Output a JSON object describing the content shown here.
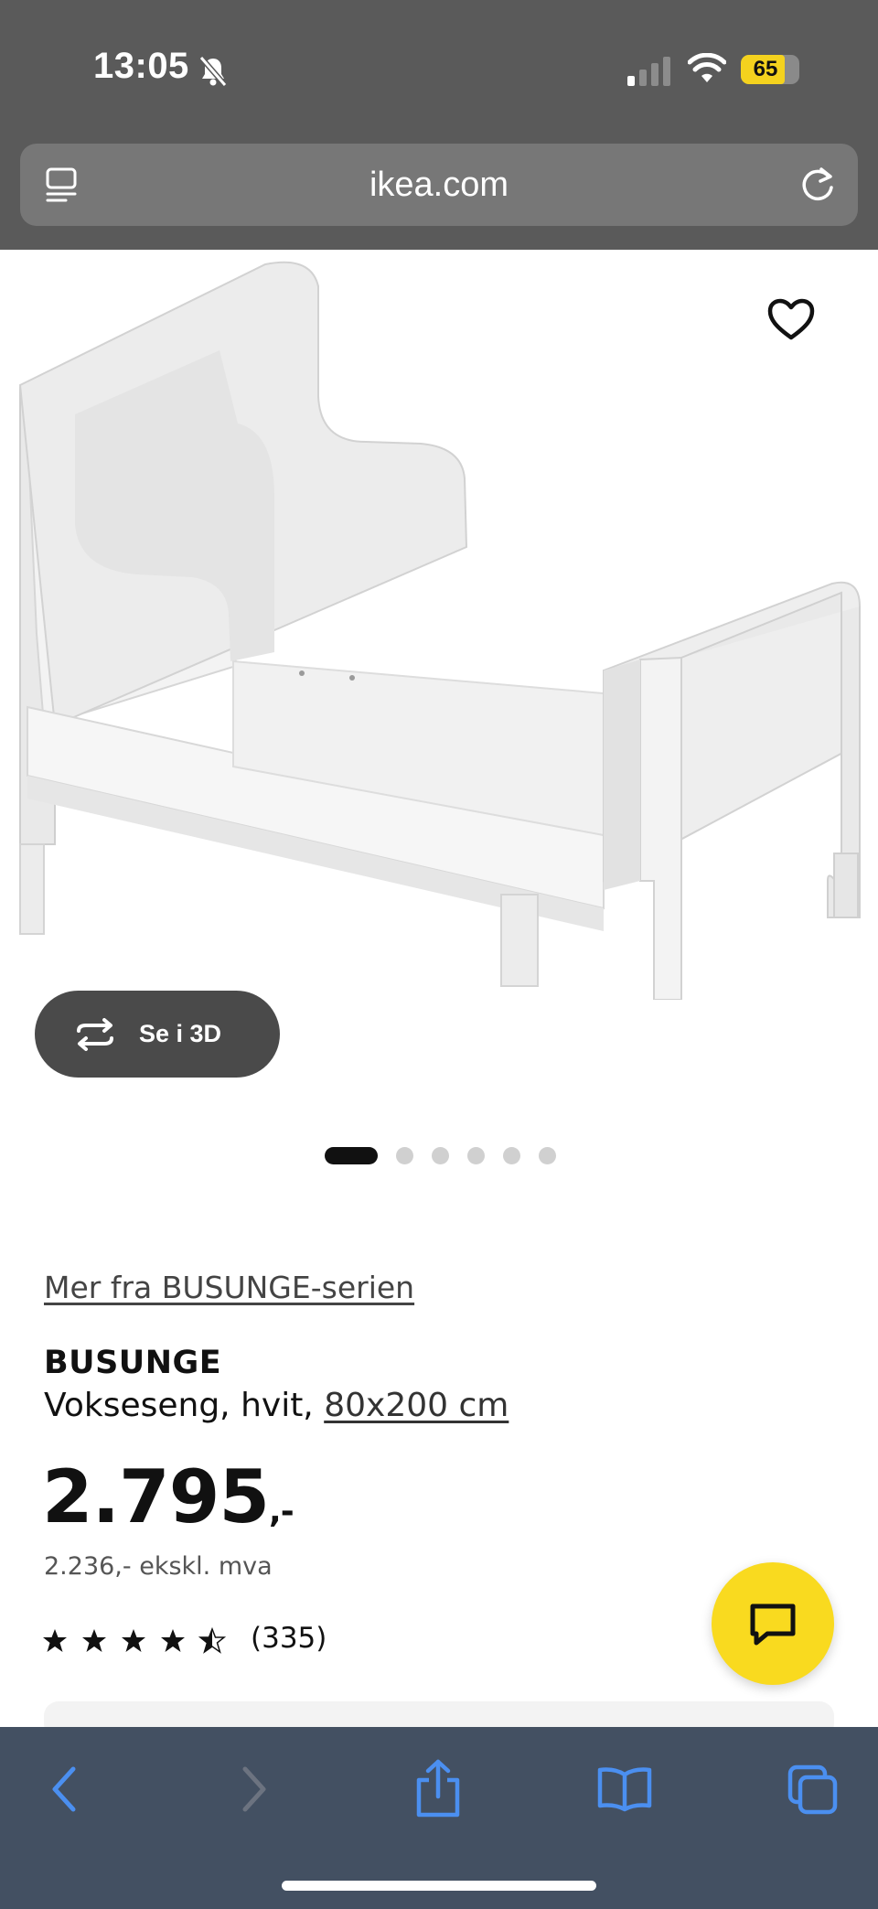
{
  "status_bar": {
    "time": "13:05",
    "battery_level": "65",
    "icons": [
      "bell-slash-icon",
      "signal-icon",
      "wifi-icon",
      "battery-icon"
    ]
  },
  "browser": {
    "url": "ikea.com",
    "icons": [
      "page-menu-icon",
      "reload-icon"
    ]
  },
  "gallery": {
    "view_3d_label": "Se i 3D",
    "image_count": 6,
    "active_image": 1,
    "icons": [
      "heart-icon",
      "rotate-3d-icon"
    ]
  },
  "product": {
    "series_link": "Mer fra BUSUNGE-serien",
    "name": "BUSUNGE",
    "description": "Vokseseng, hvit,",
    "size": "80x200 cm",
    "price": "2.795",
    "price_suffix": ",-",
    "price_ex_vat": "2.236,- ekskl. mva",
    "rating": 4.5,
    "rating_max": 5,
    "review_count": "(335)"
  },
  "chat": {
    "icon": "chat-icon",
    "color": "#f9da1f"
  },
  "toolbar": {
    "items": [
      "back-icon",
      "forward-icon",
      "share-icon",
      "bookmarks-icon",
      "tabs-icon"
    ],
    "accent": "#4b8ff0"
  }
}
